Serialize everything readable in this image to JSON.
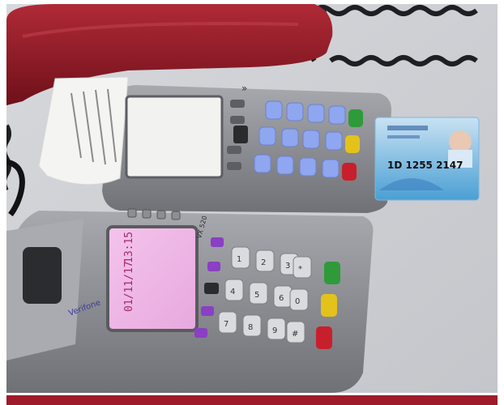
{
  "photo": {
    "terminal_top": {
      "screen_arrow": "»"
    },
    "terminal_bottom": {
      "brand": "Verifone",
      "model": "VX 520",
      "screen_line_date": "01/11/17",
      "screen_line_time": "13:15"
    },
    "id_card": {
      "number": "1D  1255  2147"
    },
    "keypad_digits": [
      "1",
      "2",
      "3",
      "4",
      "5",
      "6",
      "7",
      "8",
      "9",
      "*",
      "0",
      "#"
    ]
  },
  "colors": {
    "accent_bar": "#9d1b2b",
    "phone": "#8e1a26",
    "terminal": "#8a8c92",
    "key_blue": "#8fa6f0",
    "key_green": "#2f9a3a",
    "key_yellow": "#e3c21c",
    "key_red": "#c7202c"
  }
}
